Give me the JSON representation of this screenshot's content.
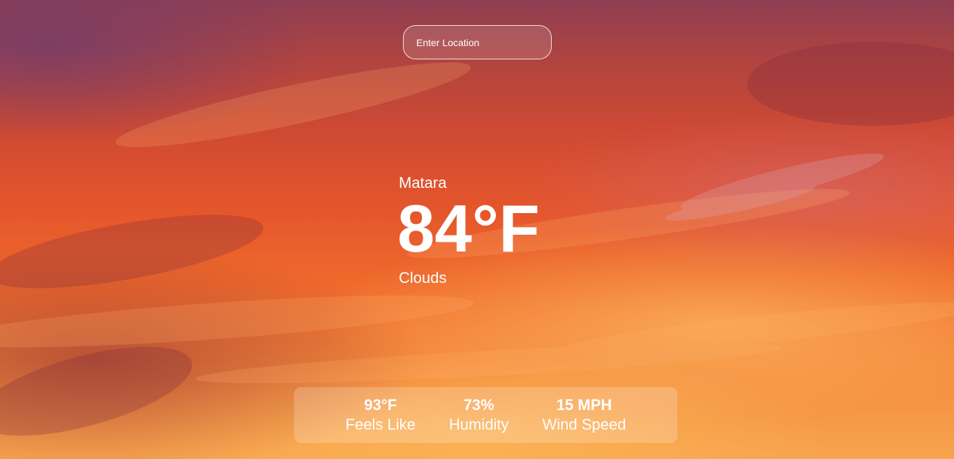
{
  "search": {
    "placeholder": "Enter Location"
  },
  "current": {
    "location": "Matara",
    "temperature": "84°F",
    "description": "Clouds"
  },
  "stats": [
    {
      "value": "93°F",
      "label": "Feels Like"
    },
    {
      "value": "73%",
      "label": "Humidity"
    },
    {
      "value": "15 MPH",
      "label": "Wind Speed"
    }
  ],
  "colors": {
    "text": "#ffffff",
    "sky_top": "#8e3e52",
    "sky_mid": "#e4552b",
    "sky_bottom": "#f7a44f"
  }
}
